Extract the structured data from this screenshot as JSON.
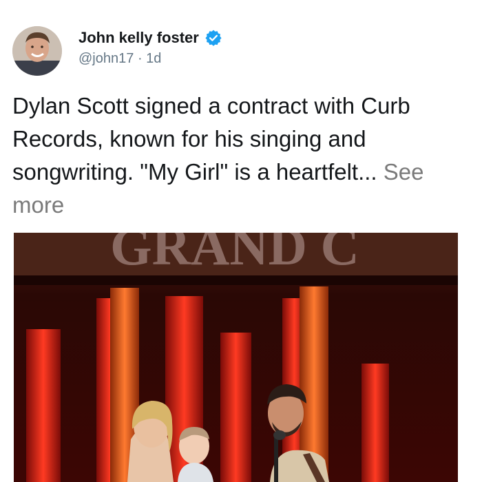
{
  "author": {
    "display_name": "John kelly foster",
    "handle": "@john17",
    "separator": "·",
    "time": "1d",
    "verified_icon": "verified-badge-icon",
    "avatar_icon": "user-avatar"
  },
  "tweet": {
    "text": "Dylan Scott signed a contract with Curb Records, known for his singing and songwriting. \"My Girl\" is a heartfelt...",
    "see_more": "See more"
  },
  "media": {
    "sign_text": "GRAND C",
    "description_icon": "stage-performance-photo"
  },
  "colors": {
    "verified_blue": "#1da1f2",
    "text_primary": "#14171a",
    "text_secondary": "#657786",
    "see_more": "#7a7a7a"
  }
}
